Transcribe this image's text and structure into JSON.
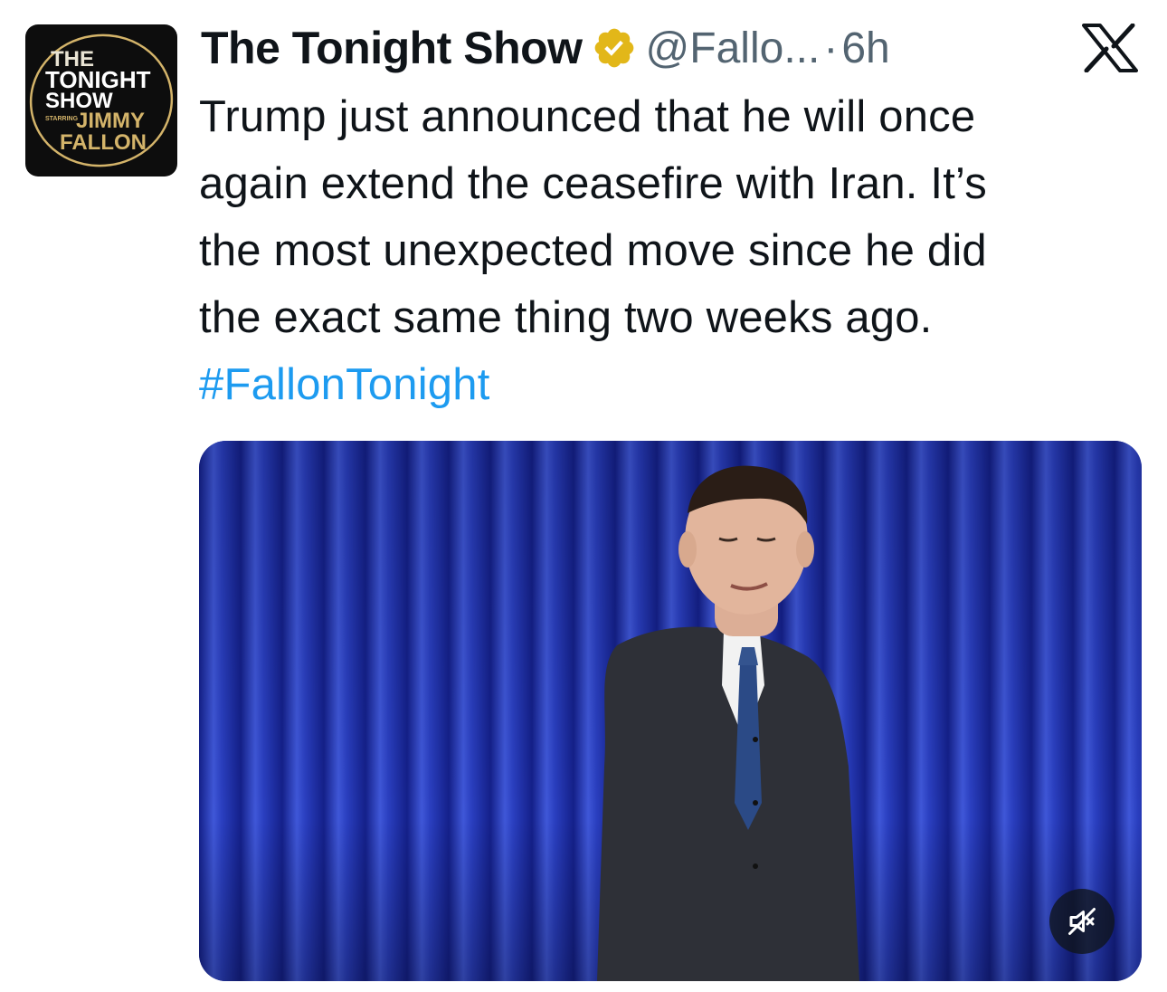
{
  "tweet": {
    "avatar": {
      "logo_lines": [
        "THE",
        "TONIGHT",
        "SHOW",
        "STARRING",
        "JIMMY",
        "FALLON"
      ]
    },
    "author": {
      "name": "The Tonight Show",
      "handle": "@Fallo...",
      "separator": "·",
      "time": "6h",
      "verified_badge_icon": "verified-gold-badge-icon",
      "verified_badge_color": "#e2b719"
    },
    "x_logo_icon": "x-logo-icon",
    "text_lines": [
      "Trump just announced that he will once",
      "again extend the ceasefire with Iran. It’s",
      "the most unexpected move since he did",
      "the exact same thing two weeks ago."
    ],
    "hashtag": "#FallonTonight",
    "media": {
      "type": "video",
      "mute_icon": "speaker-muted-icon"
    },
    "colors": {
      "text": "#0f1419",
      "secondary_text": "#536471",
      "link": "#1d9bf0",
      "logo_gold": "#d4b46a"
    }
  }
}
